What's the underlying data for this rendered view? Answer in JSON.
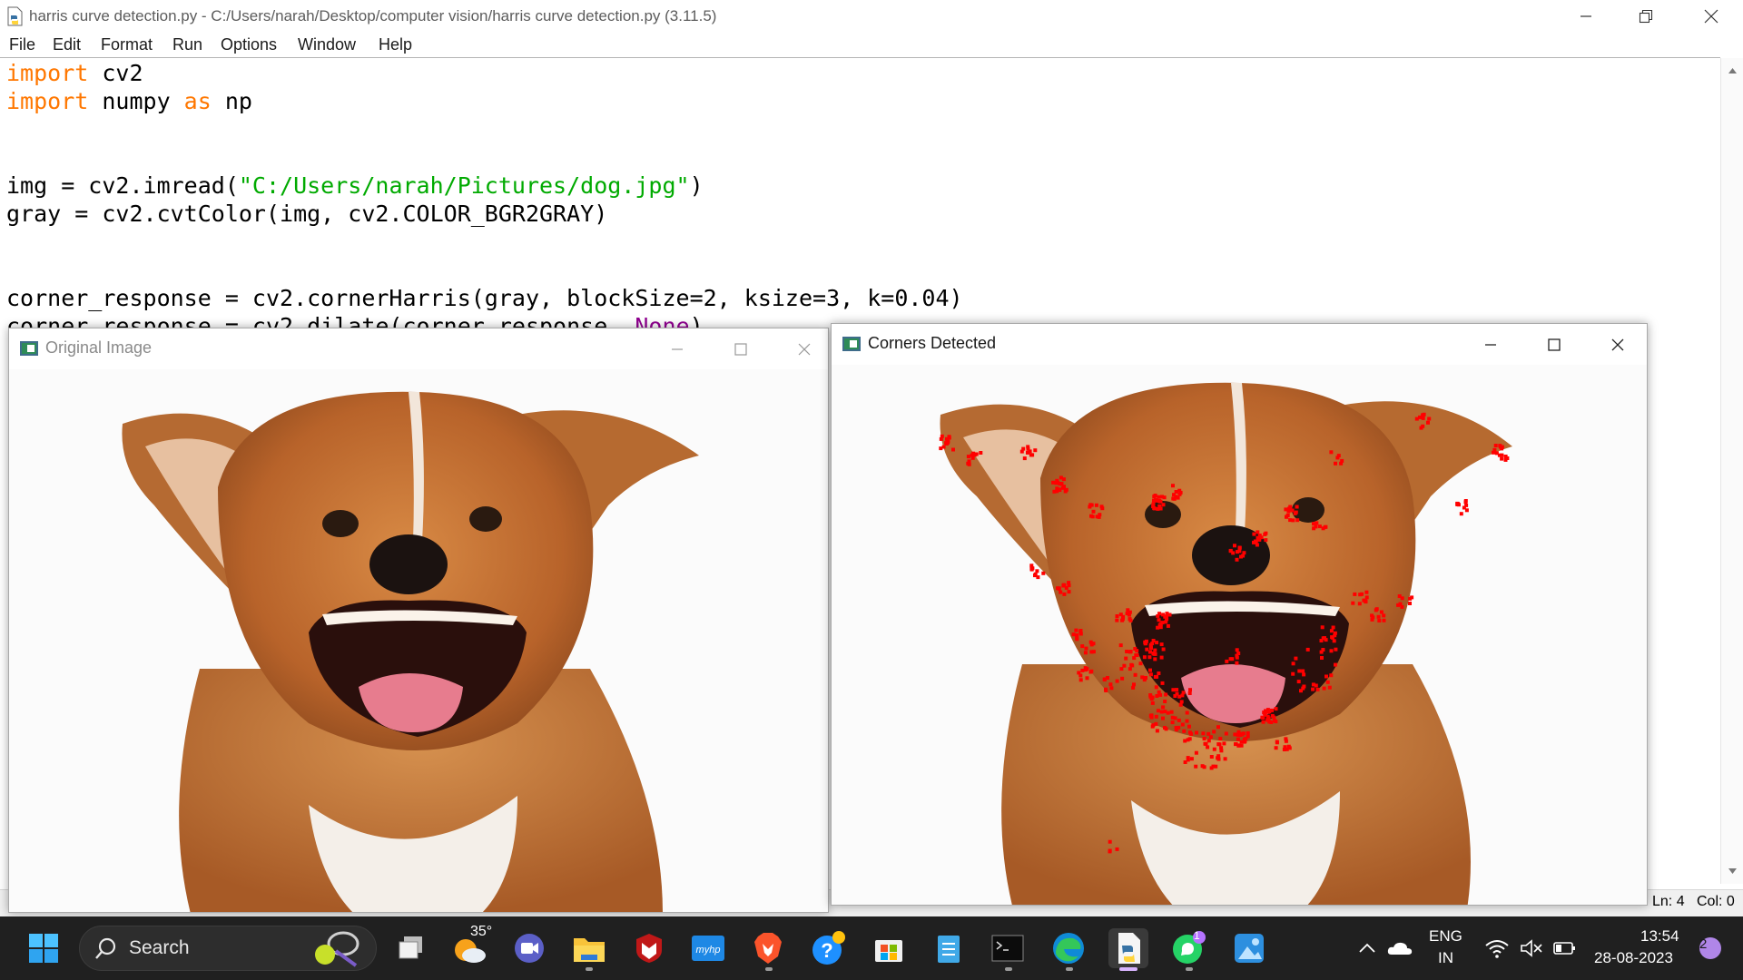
{
  "idle": {
    "title": "harris curve detection.py - C:/Users/narah/Desktop/computer vision/harris curve detection.py (3.11.5)",
    "menu": [
      "File",
      "Edit",
      "Format",
      "Run",
      "Options",
      "Window",
      "Help"
    ],
    "code": {
      "l1_kw": "import",
      "l1_rest": " cv2",
      "l2_kw": "import",
      "l2_mid": " numpy ",
      "l2_as": "as",
      "l2_rest": " np",
      "l5_pre": "img = cv2.imread(",
      "l5_str": "\"C:/Users/narah/Pictures/dog.jpg\"",
      "l5_post": ")",
      "l6": "gray = cv2.cvtColor(img, cv2.COLOR_BGR2GRAY)",
      "l9": "corner_response = cv2.cornerHarris(gray, blockSize=2, ksize=3, k=0.04)",
      "l10_pre": "corner_response = cv2.dilate(corner_response, ",
      "l10_none": "None",
      "l10_post": ")"
    },
    "status": {
      "line": "Ln: 4",
      "col": "Col: 0"
    }
  },
  "window_original": {
    "title": "Original Image"
  },
  "window_corners": {
    "title": "Corners Detected"
  },
  "taskbar": {
    "search_label": "Search",
    "weather_temp": "35°",
    "language_top": "ENG",
    "language_bottom": "IN",
    "time": "13:54",
    "date": "28-08-2023",
    "notification_count": "2",
    "whatsapp_badge": "1"
  },
  "colors": {
    "keyword": "#ff7700",
    "string": "#00aa00",
    "builtin_none": "#900090",
    "corner_marker": "#ff0000",
    "taskbar_bg": "#202020"
  }
}
